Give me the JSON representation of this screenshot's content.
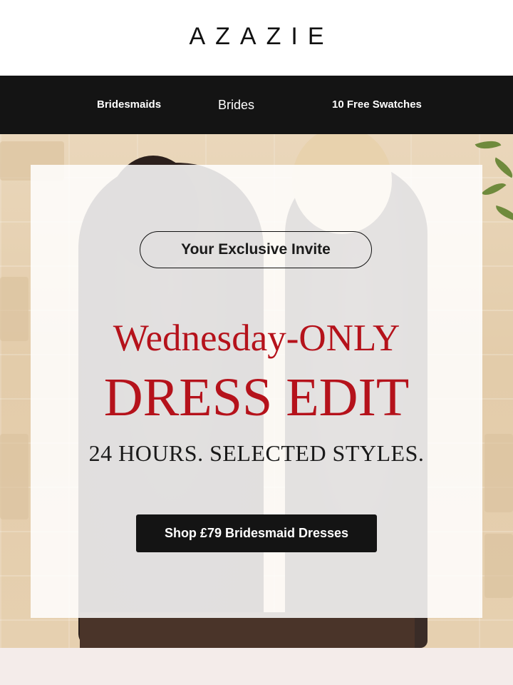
{
  "brand": {
    "logo_text": "AZAZIE"
  },
  "nav": {
    "items": [
      {
        "label": "Bridesmaids"
      },
      {
        "label": "Brides"
      },
      {
        "label": "10 Free Swatches"
      }
    ]
  },
  "hero": {
    "invite_label": "Your Exclusive Invite",
    "headline_line1": "Wednesday-ONLY",
    "headline_line2": "DRESS EDIT",
    "subheadline": "24 HOURS. SELECTED STYLES.",
    "cta_label": "Shop £79 Bridesmaid Dresses"
  },
  "colors": {
    "nav_background": "#141414",
    "headline_red": "#b5121b",
    "cta_background": "#141414",
    "bottom_band": "#f4ecea"
  }
}
